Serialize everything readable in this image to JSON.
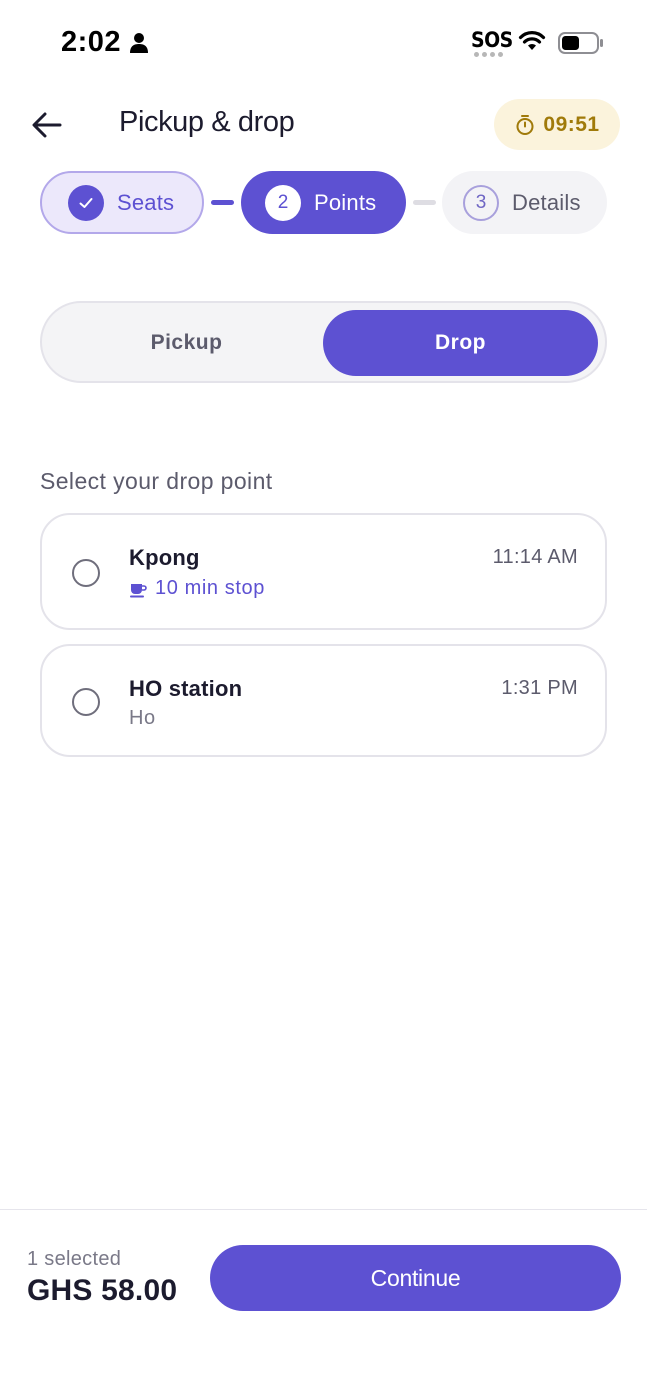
{
  "status_bar": {
    "time": "2:02",
    "sos": "SOS",
    "icons": [
      "person-icon",
      "wifi-icon",
      "battery-icon"
    ]
  },
  "header": {
    "title": "Pickup & drop",
    "timer": "09:51",
    "icons": [
      "back-arrow-icon",
      "stopwatch-icon"
    ]
  },
  "stepper": {
    "steps": [
      {
        "number": "",
        "label": "Seats",
        "state": "completed"
      },
      {
        "number": "2",
        "label": "Points",
        "state": "active"
      },
      {
        "number": "3",
        "label": "Details",
        "state": "upcoming"
      }
    ]
  },
  "segment": {
    "options": [
      "Pickup",
      "Drop"
    ],
    "selected": "Drop"
  },
  "drop_section": {
    "heading": "Select your drop point",
    "points": [
      {
        "name": "Kpong",
        "time": "11:14 AM",
        "subtitle": "10 min stop",
        "subtitle_icon": "cup-icon",
        "selected": false
      },
      {
        "name": "HO station",
        "time": "1:31 PM",
        "subtitle": "Ho",
        "selected": false
      }
    ]
  },
  "footer": {
    "selected_count": "1 selected",
    "total": "GHS 58.00",
    "continue_label": "Continue"
  },
  "colors": {
    "accent": "#5d51d2",
    "accent_light": "#ece8fb",
    "timer_bg": "#fbf3dc",
    "timer_text": "#a07a0a",
    "text_primary": "#1c1b2e",
    "text_secondary": "#5c5b6c"
  }
}
